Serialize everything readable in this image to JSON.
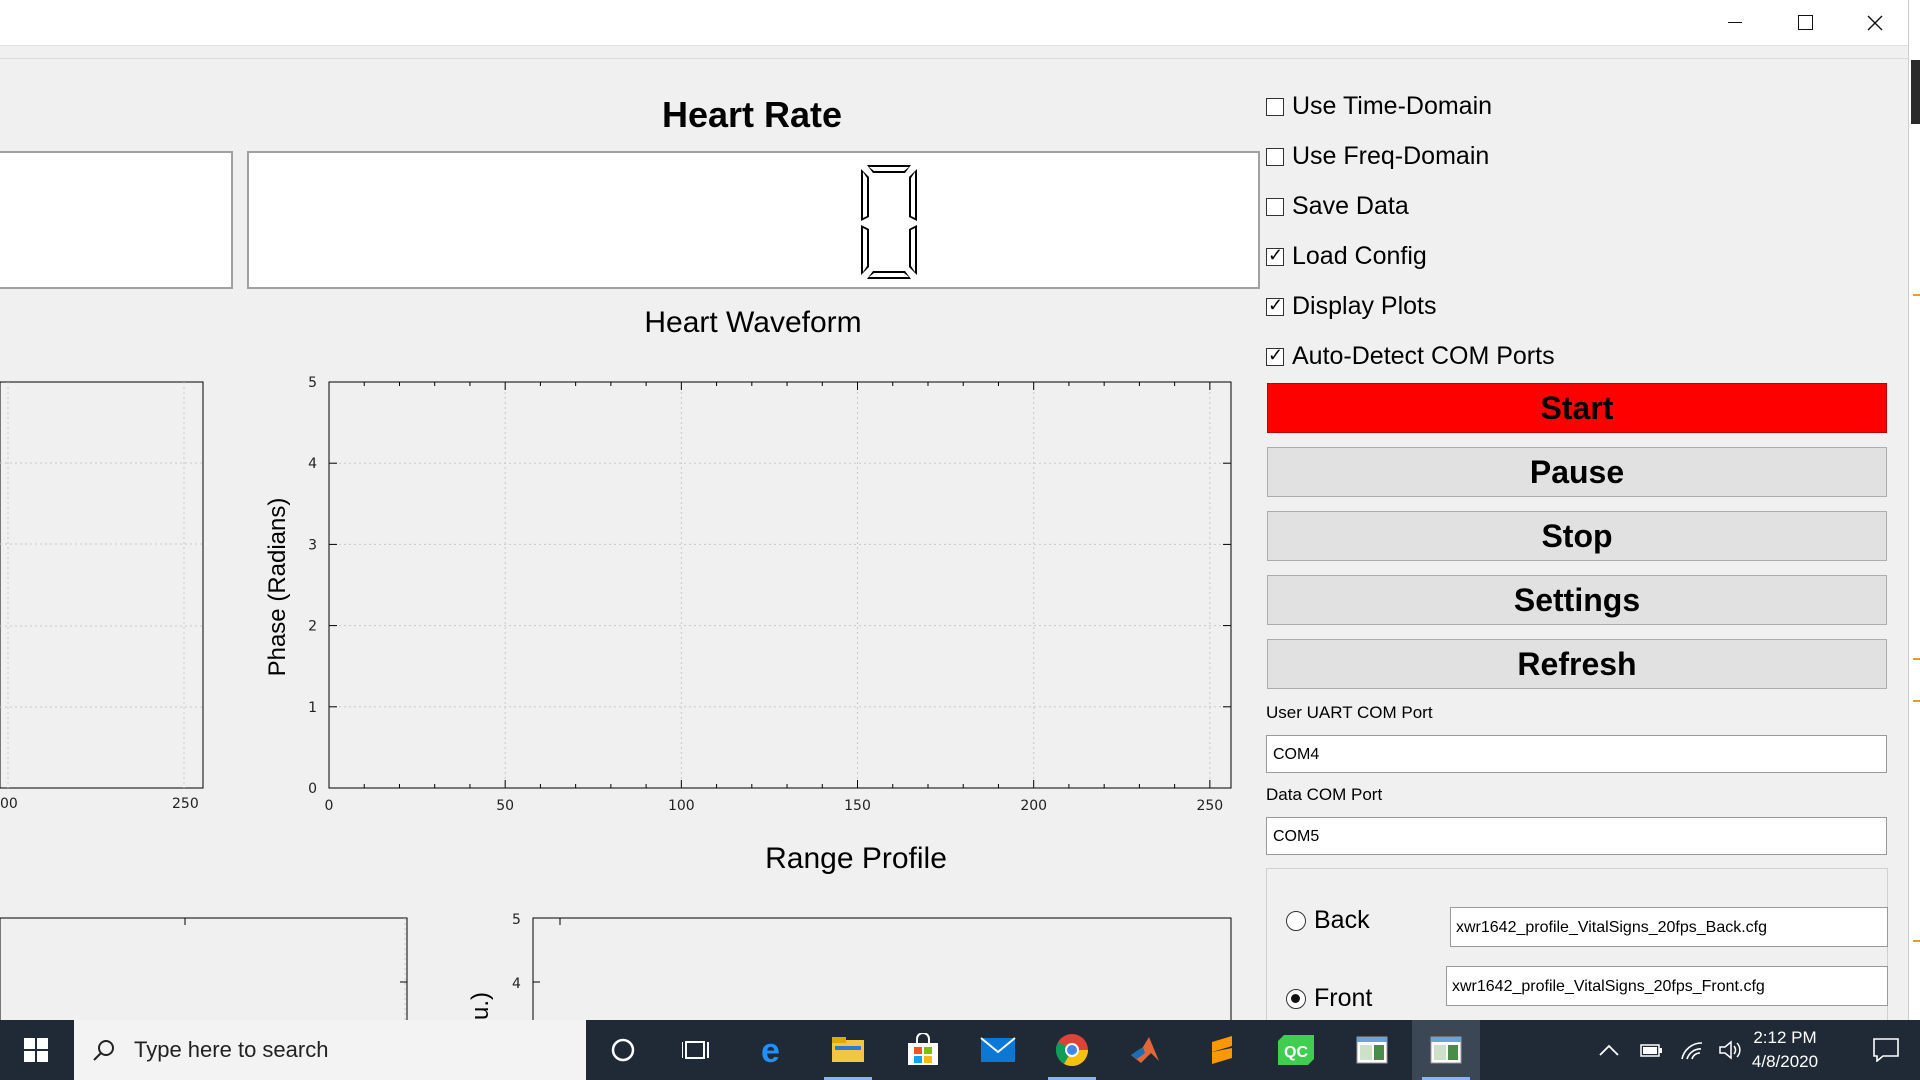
{
  "window": {
    "minimize_icon": "minimize-icon",
    "maximize_icon": "maximize-icon",
    "close_icon": "close-icon"
  },
  "heart_rate": {
    "title": "Heart Rate",
    "value": "0"
  },
  "heart_waveform": {
    "title": "Heart Waveform",
    "ylabel": "Phase (Radians)",
    "chart_data": {
      "type": "line",
      "xlim": [
        0,
        256
      ],
      "ylim": [
        0,
        5
      ],
      "xticks": [
        "0",
        "50",
        "100",
        "150",
        "200",
        "250"
      ],
      "yticks": [
        "0",
        "1",
        "2",
        "3",
        "4",
        "5"
      ],
      "series": [],
      "grid": true
    }
  },
  "left_plot": {
    "xticks": [
      "00",
      "250"
    ]
  },
  "range_profile": {
    "title": "Range Profile",
    "ylabel_fragment": "u.)",
    "yticks": [
      "5",
      "4"
    ]
  },
  "options": [
    {
      "label": "Use Time-Domain",
      "checked": false
    },
    {
      "label": "Use Freq-Domain",
      "checked": false
    },
    {
      "label": "Save Data",
      "checked": false
    },
    {
      "label": "Load Config",
      "checked": true
    },
    {
      "label": "Display Plots",
      "checked": true
    },
    {
      "label": "Auto-Detect COM Ports",
      "checked": true
    }
  ],
  "buttons": {
    "start": "Start",
    "pause": "Pause",
    "stop": "Stop",
    "settings": "Settings",
    "refresh": "Refresh"
  },
  "colors": {
    "start": "#ff0000"
  },
  "uart": {
    "label": "User UART COM Port",
    "value": "COM4"
  },
  "data_port": {
    "label": "Data COM Port",
    "value": "COM5"
  },
  "config": {
    "back": {
      "label": "Back",
      "file": "xwr1642_profile_VitalSigns_20fps_Back.cfg",
      "selected": false
    },
    "front": {
      "label": "Front",
      "file": "xwr1642_profile_VitalSigns_20fps_Front.cfg",
      "selected": true
    }
  },
  "taskbar": {
    "search_placeholder": "Type here to search",
    "time": "2:12 PM",
    "date": "4/8/2020",
    "apps": [
      "cortana-icon",
      "task-view-icon",
      "edge-icon",
      "file-explorer-icon",
      "store-icon",
      "mail-icon",
      "chrome-icon",
      "matlab-icon",
      "sublime-icon",
      "qt-creator-icon",
      "app-window-icon",
      "active-app-window-icon"
    ]
  }
}
